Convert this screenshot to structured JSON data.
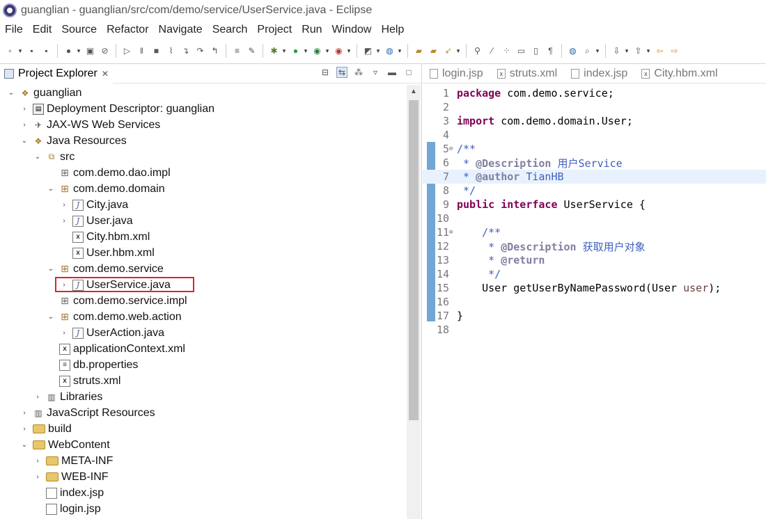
{
  "window": {
    "title": "guanglian - guanglian/src/com/demo/service/UserService.java - Eclipse"
  },
  "menu": [
    "File",
    "Edit",
    "Source",
    "Refactor",
    "Navigate",
    "Search",
    "Project",
    "Run",
    "Window",
    "Help"
  ],
  "explorer": {
    "tab_label": "Project Explorer",
    "tree": [
      {
        "label": "guanglian",
        "depth": 0,
        "twisty": "open",
        "icon": "project"
      },
      {
        "label": "Deployment Descriptor: guanglian",
        "depth": 1,
        "twisty": "closed",
        "icon": "dd"
      },
      {
        "label": "JAX-WS Web Services",
        "depth": 1,
        "twisty": "closed",
        "icon": "ws"
      },
      {
        "label": "Java Resources",
        "depth": 1,
        "twisty": "open",
        "icon": "jres"
      },
      {
        "label": "src",
        "depth": 2,
        "twisty": "open",
        "icon": "src"
      },
      {
        "label": "com.demo.dao.impl",
        "depth": 3,
        "twisty": "none",
        "icon": "pkg-empty"
      },
      {
        "label": "com.demo.domain",
        "depth": 3,
        "twisty": "open",
        "icon": "pkg"
      },
      {
        "label": "City.java",
        "depth": 4,
        "twisty": "closed",
        "icon": "java"
      },
      {
        "label": "User.java",
        "depth": 4,
        "twisty": "closed",
        "icon": "java"
      },
      {
        "label": "City.hbm.xml",
        "depth": 4,
        "twisty": "none",
        "icon": "xml"
      },
      {
        "label": "User.hbm.xml",
        "depth": 4,
        "twisty": "none",
        "icon": "xml"
      },
      {
        "label": "com.demo.service",
        "depth": 3,
        "twisty": "open",
        "icon": "pkg"
      },
      {
        "label": "UserService.java",
        "depth": 4,
        "twisty": "closed",
        "icon": "java",
        "selected": true
      },
      {
        "label": "com.demo.service.impl",
        "depth": 3,
        "twisty": "none",
        "icon": "pkg-empty"
      },
      {
        "label": "com.demo.web.action",
        "depth": 3,
        "twisty": "open",
        "icon": "pkg"
      },
      {
        "label": "UserAction.java",
        "depth": 4,
        "twisty": "closed",
        "icon": "java"
      },
      {
        "label": "applicationContext.xml",
        "depth": 3,
        "twisty": "none",
        "icon": "xml"
      },
      {
        "label": "db.properties",
        "depth": 3,
        "twisty": "none",
        "icon": "props"
      },
      {
        "label": "struts.xml",
        "depth": 3,
        "twisty": "none",
        "icon": "xml"
      },
      {
        "label": "Libraries",
        "depth": 2,
        "twisty": "closed",
        "icon": "lib"
      },
      {
        "label": "JavaScript Resources",
        "depth": 1,
        "twisty": "closed",
        "icon": "jsres"
      },
      {
        "label": "build",
        "depth": 1,
        "twisty": "closed",
        "icon": "folder"
      },
      {
        "label": "WebContent",
        "depth": 1,
        "twisty": "open",
        "icon": "folder"
      },
      {
        "label": "META-INF",
        "depth": 2,
        "twisty": "closed",
        "icon": "folder"
      },
      {
        "label": "WEB-INF",
        "depth": 2,
        "twisty": "closed",
        "icon": "folder"
      },
      {
        "label": "index.jsp",
        "depth": 2,
        "twisty": "none",
        "icon": "jsp"
      },
      {
        "label": "login.jsp",
        "depth": 2,
        "twisty": "none",
        "icon": "jsp"
      }
    ]
  },
  "editor": {
    "tabs": [
      {
        "label": "login.jsp",
        "icon": "jsp"
      },
      {
        "label": "struts.xml",
        "icon": "xml"
      },
      {
        "label": "index.jsp",
        "icon": "jsp"
      },
      {
        "label": "City.hbm.xml",
        "icon": "xml"
      }
    ],
    "line_numbers": [
      "1",
      "2",
      "3",
      "4",
      "5",
      "6",
      "7",
      "8",
      "9",
      "10",
      "11",
      "12",
      "13",
      "14",
      "15",
      "16",
      "17",
      "18"
    ]
  },
  "colors": {
    "selection_box": "#d9242b",
    "keyword": "#7f0055",
    "javadoc": "#3f5fbf",
    "javadoc_tag": "#7f7f9f",
    "current_line": "#e8f2fe"
  }
}
